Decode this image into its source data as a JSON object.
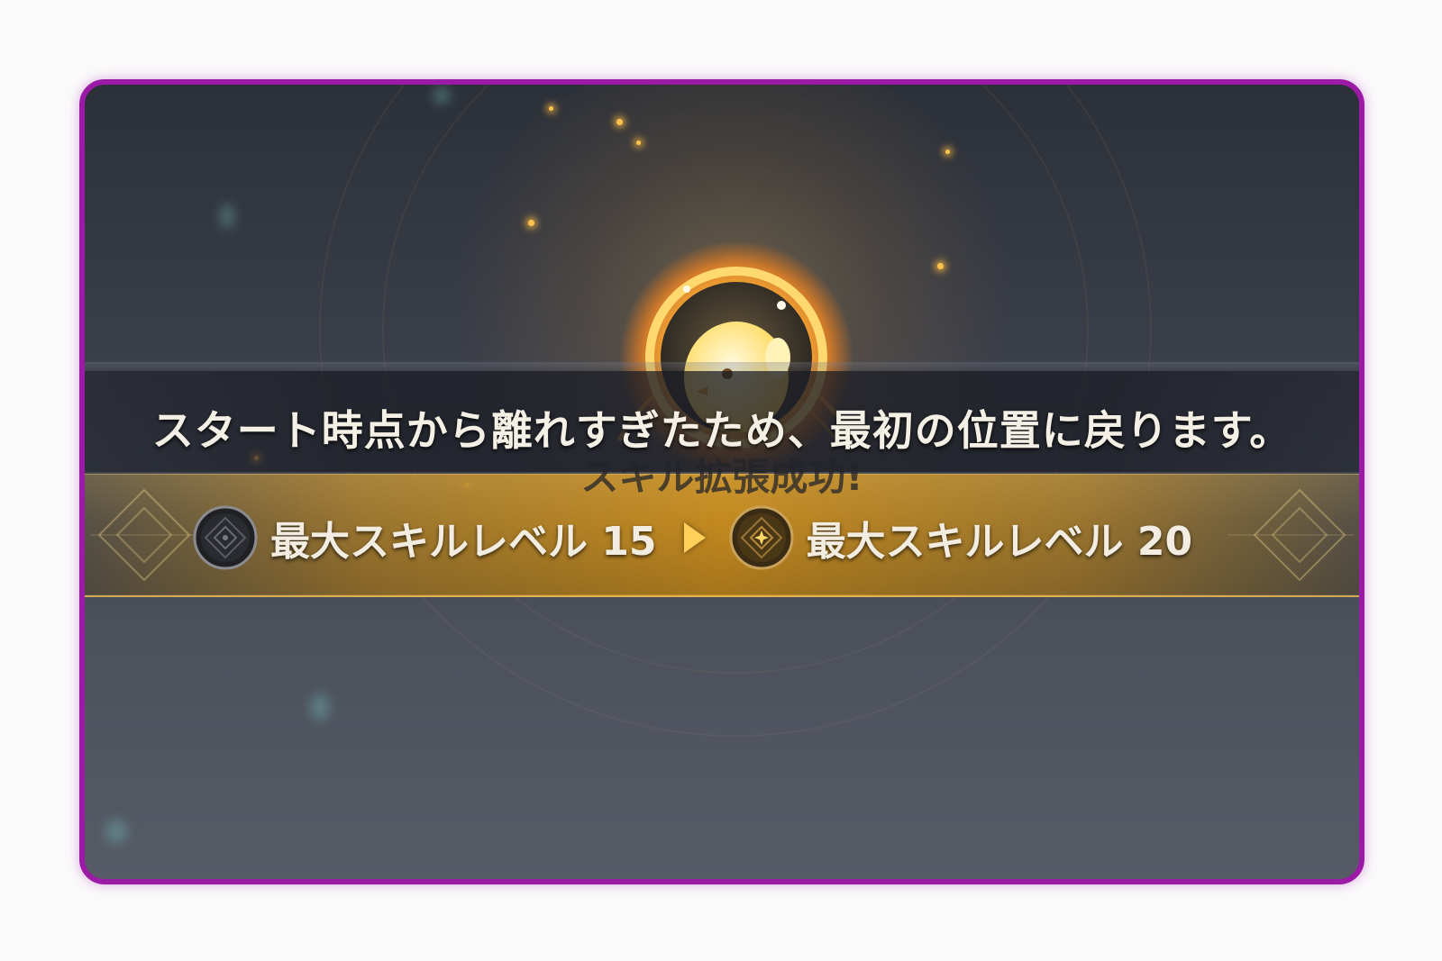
{
  "notification": {
    "message": "スタート時点から離れすぎたため、最初の位置に戻ります。"
  },
  "result": {
    "title": "スキル拡張成功!",
    "before": {
      "label": "最大スキルレベル 15",
      "icon": "locked-skill-emblem-icon"
    },
    "after": {
      "label": "最大スキルレベル 20",
      "icon": "gold-skill-emblem-icon"
    },
    "arrow_icon": "right-arrow-icon"
  },
  "emblem": {
    "icon": "chick-medallion-icon"
  },
  "colors": {
    "frame_border": "#9b1aa6",
    "banner_gold": "#c2891f",
    "arrow": "#ffcf5a",
    "text": "#f4f0e6"
  }
}
